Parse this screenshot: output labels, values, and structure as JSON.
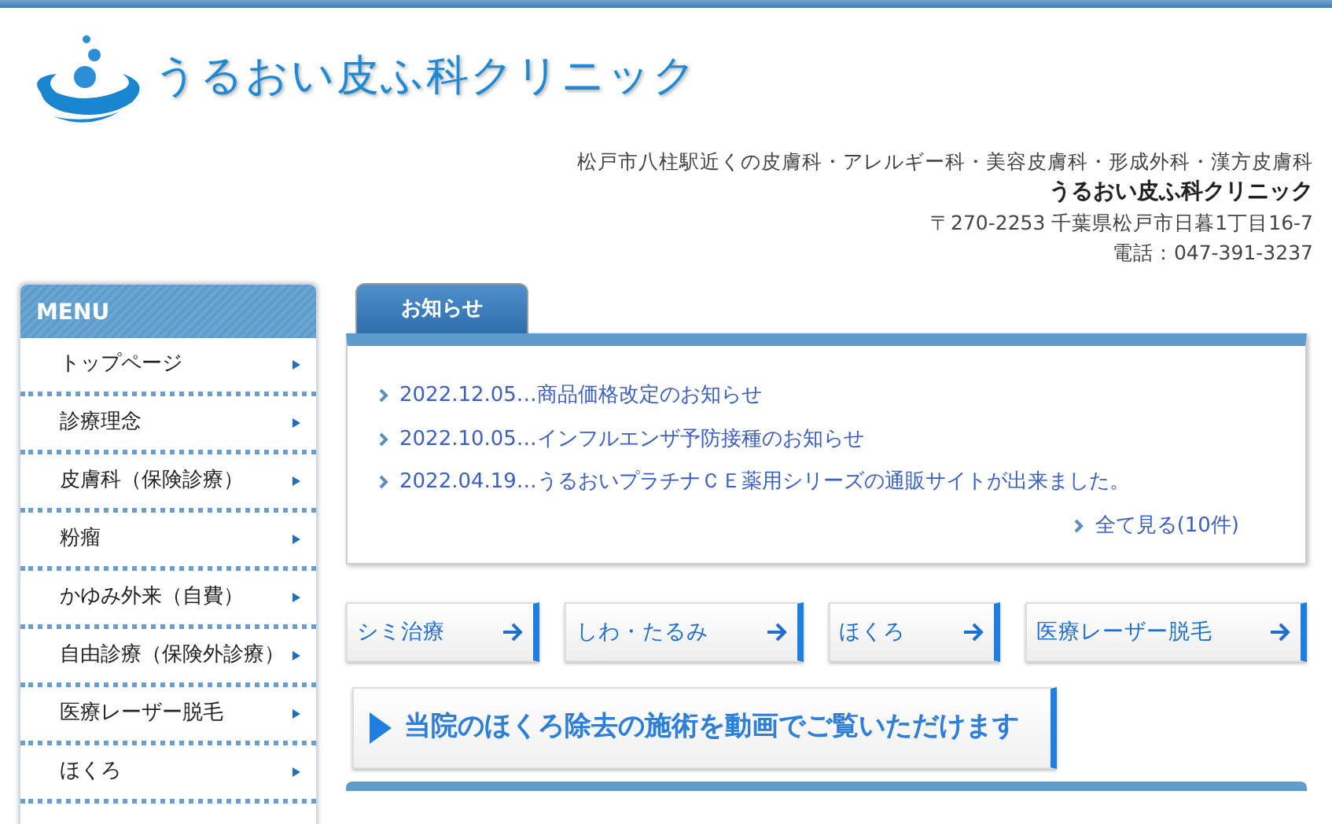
{
  "header": {
    "logo_text": "うるおい皮ふ科クリニック",
    "tagline": "松戸市八柱駅近くの皮膚科・アレルギー科・美容皮膚科・形成外科・漢方皮膚科",
    "clinic_name": "うるおい皮ふ科クリニック",
    "address": "〒270-2253 千葉県松戸市日暮1丁目16-7",
    "phone": "電話：047-391-3237"
  },
  "sidebar": {
    "title": "MENU",
    "items": [
      {
        "label": "トップページ"
      },
      {
        "label": "診療理念"
      },
      {
        "label": "皮膚科（保険診療）"
      },
      {
        "label": "粉瘤"
      },
      {
        "label": "かゆみ外来（自費）"
      },
      {
        "label": "自由診療（保険外診療）"
      },
      {
        "label": "医療レーザー脱毛"
      },
      {
        "label": "ほくろ"
      }
    ]
  },
  "news": {
    "tab": "お知らせ",
    "items": [
      {
        "text": "2022.12.05…商品価格改定のお知らせ"
      },
      {
        "text": "2022.10.05…インフルエンザ予防接種のお知らせ"
      },
      {
        "text": "2022.04.19…うるおいプラチナＣＥ薬用シリーズの通販サイトが出来ました。"
      }
    ],
    "more": "全て見る(10件)"
  },
  "links": [
    {
      "label": "シミ治療"
    },
    {
      "label": "しわ・たるみ"
    },
    {
      "label": "ほくろ"
    },
    {
      "label": "医療レーザー脱毛"
    }
  ],
  "video_banner": {
    "text": "当院のほくろ除去の施術を動画でご覧いただけます"
  }
}
